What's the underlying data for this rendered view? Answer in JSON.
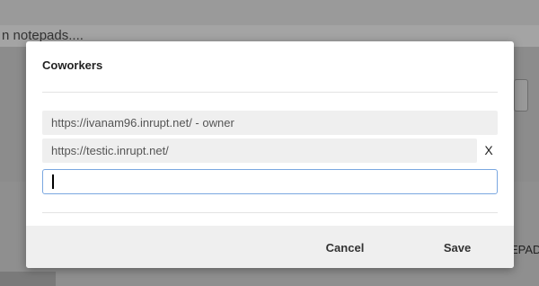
{
  "background": {
    "search_placeholder": "n notepads....",
    "right_label": "EPAD"
  },
  "modal": {
    "title": "Coworkers",
    "coworkers": [
      {
        "label": "https://ivanam96.inrupt.net/ - owner"
      },
      {
        "label": "https://testic.inrupt.net/",
        "remove_label": "X"
      }
    ],
    "new_coworker_value": "",
    "cancel_label": "Cancel",
    "save_label": "Save"
  }
}
